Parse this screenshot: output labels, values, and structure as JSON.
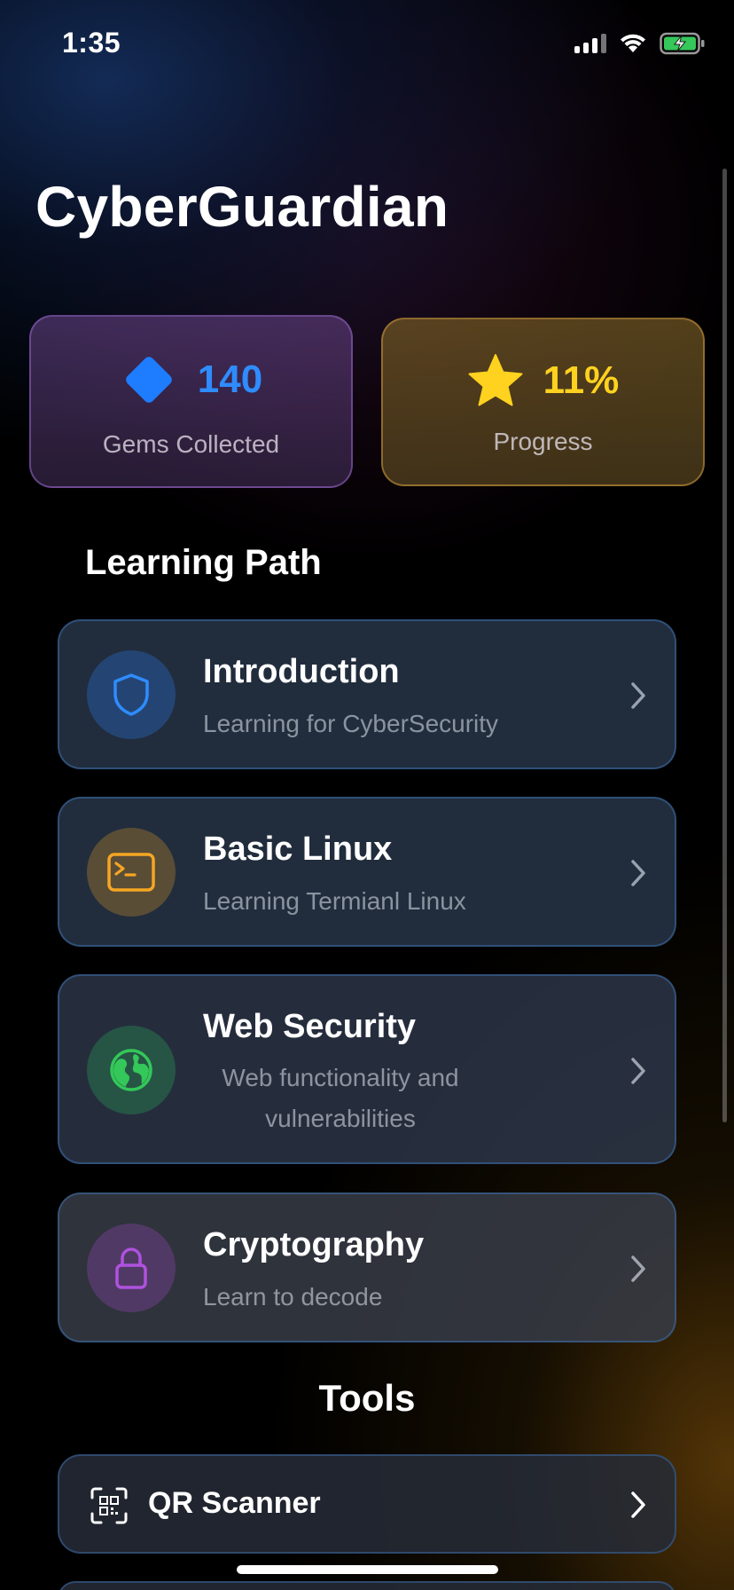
{
  "status_bar": {
    "time": "1:35",
    "battery_charging": true
  },
  "app": {
    "title": "CyberGuardian"
  },
  "stats": {
    "gems": {
      "value": "140",
      "label": "Gems Collected",
      "icon": "diamond-icon",
      "color": "#2f8cff"
    },
    "progress": {
      "value": "11%",
      "label": "Progress",
      "icon": "star-icon",
      "color": "#ffd21f"
    }
  },
  "learning_path": {
    "title": "Learning Path",
    "items": [
      {
        "title": "Introduction",
        "subtitle": "Learning for CyberSecurity",
        "icon": "shield-icon",
        "color": "#2f8cff"
      },
      {
        "title": "Basic Linux",
        "subtitle": "Learning Termianl Linux",
        "icon": "terminal-icon",
        "color": "#f5a623"
      },
      {
        "title": "Web Security",
        "subtitle": "Web functionality and vulnerabilities",
        "icon": "globe-icon",
        "color": "#34c759"
      },
      {
        "title": "Cryptography",
        "subtitle": "Learn to decode",
        "icon": "lock-icon",
        "color": "#af52de"
      }
    ]
  },
  "tools": {
    "title": "Tools",
    "items": [
      {
        "label": "QR Scanner",
        "icon": "qr-scan-icon"
      }
    ]
  }
}
